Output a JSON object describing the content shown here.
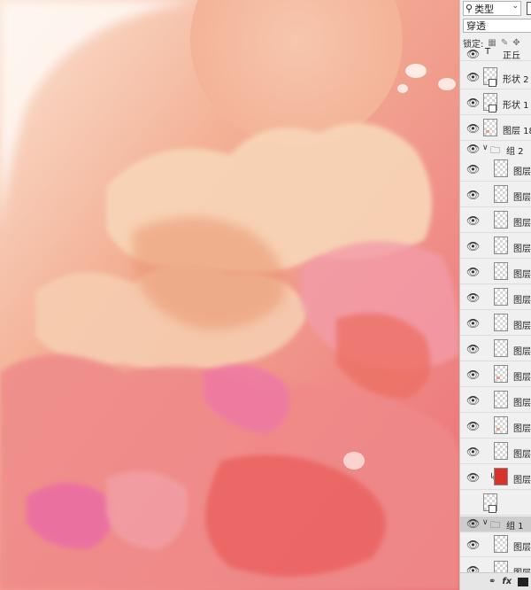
{
  "layers_panel": {
    "filter_label": "类型",
    "blend_mode": "穿透",
    "lock_label": "锁定:",
    "layers": [
      {
        "name": "正丘",
        "kind": "text"
      },
      {
        "name": "形状 2",
        "kind": "shape"
      },
      {
        "name": "形状 1",
        "kind": "shape"
      },
      {
        "name": "图层 18",
        "kind": "pixel"
      },
      {
        "name": "组 2",
        "kind": "group"
      },
      {
        "name": "图层",
        "kind": "pixel"
      },
      {
        "name": "图层",
        "kind": "pixel"
      },
      {
        "name": "图层",
        "kind": "pixel"
      },
      {
        "name": "图层",
        "kind": "pixel"
      },
      {
        "name": "图层",
        "kind": "pixel"
      },
      {
        "name": "图层",
        "kind": "pixel"
      },
      {
        "name": "图层",
        "kind": "pixel"
      },
      {
        "name": "图层",
        "kind": "pixel"
      },
      {
        "name": "图层",
        "kind": "pixel"
      },
      {
        "name": "图层",
        "kind": "pixel"
      },
      {
        "name": "图层",
        "kind": "pixel"
      },
      {
        "name": "图层",
        "kind": "pixel"
      },
      {
        "name": "图层",
        "kind": "pixel",
        "clipped": true
      },
      {
        "name": "",
        "kind": "shape"
      },
      {
        "name": "组 1",
        "kind": "group",
        "selected": true
      },
      {
        "name": "图层",
        "kind": "pixel"
      },
      {
        "name": "图层",
        "kind": "pixel"
      }
    ],
    "footer_icons": [
      "link-icon",
      "fx-icon",
      "mask-icon"
    ],
    "footer_fx": "fx"
  },
  "colors": {
    "panel_bg": "#f0f0f0",
    "selected_row": "#cdcdcd",
    "canvas_peach": "#f3b196",
    "canvas_pink": "#ef7a7e",
    "canvas_cream": "#f8d4b6",
    "sun": "#f6bda3"
  }
}
